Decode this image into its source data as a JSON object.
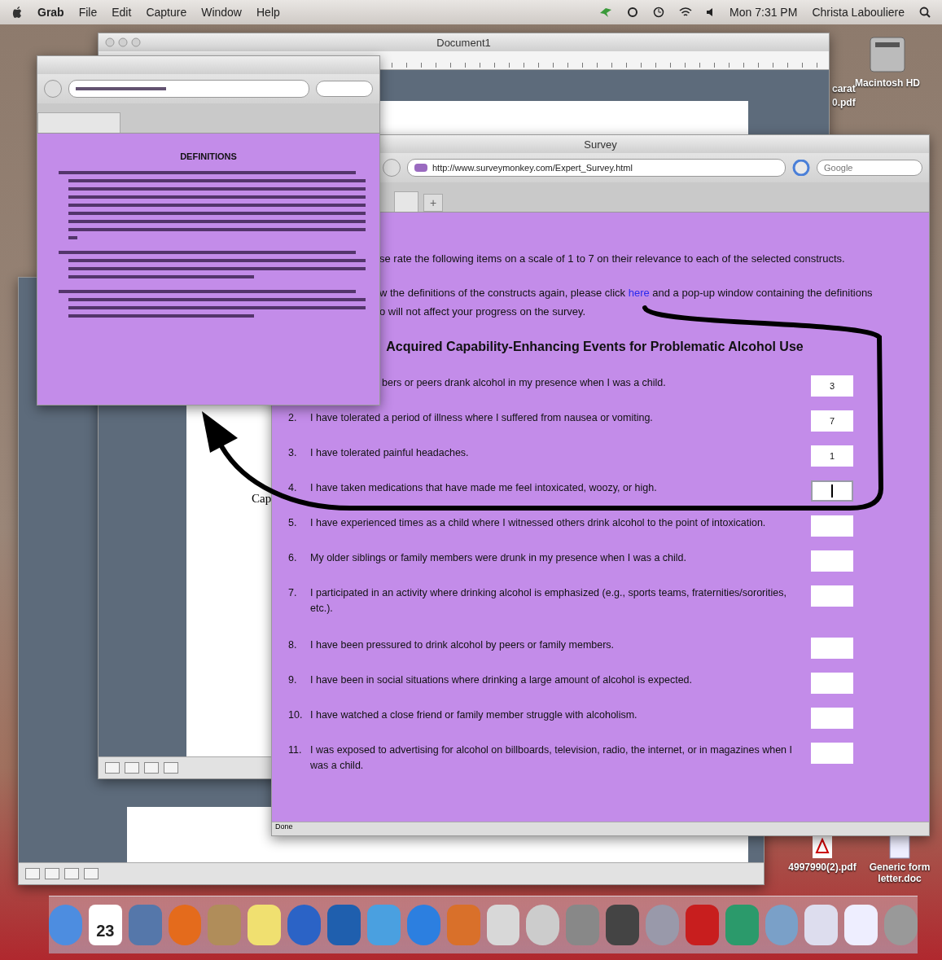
{
  "menu_bar": {
    "app_name": "Grab",
    "menus": [
      "File",
      "Edit",
      "Capture",
      "Window",
      "Help"
    ],
    "clock": "Mon 7:31 PM",
    "user": "Christa Labouliere"
  },
  "document_window": {
    "title": "Document1",
    "page_text": "Cap"
  },
  "definitions_window": {
    "heading": "DEFINITIONS"
  },
  "survey_window": {
    "title": "Survey",
    "url": "http://www.surveymonkey.com/Expert_Survey.html",
    "search_placeholder": "Google",
    "new_tab": "+",
    "intro_1": "se rate the following items on a scale of 1 to 7 on their relevance to each of the selected constructs.",
    "intro_2": {
      "before": "w the definitions of the constructs again, please click ",
      "link": "here",
      "after": " and a pop-up window containing the definitions"
    },
    "intro_3": "o will not affect your progress on the survey.",
    "heading": "Acquired Capability-Enhancing Events for Problematic Alcohol Use",
    "items": [
      {
        "text": "bers or peers drank alcohol in my presence when I was a child.",
        "answer": "3",
        "focused": false
      },
      {
        "number": "2.",
        "text": "I have tolerated a period of illness where I suffered from nausea or vomiting.",
        "answer": "7",
        "focused": false
      },
      {
        "number": "3.",
        "text": "I have tolerated painful headaches.",
        "answer": "1",
        "focused": false
      },
      {
        "number": "4.",
        "text": "I have taken medications that have made me feel intoxicated, woozy, or high.",
        "focused": true
      },
      {
        "number": "5.",
        "text": "I have experienced times as a child where I witnessed others drink alcohol to the point of intoxication.",
        "focused": false
      },
      {
        "number": "6.",
        "text": "My older siblings or family members were drunk in my presence when I was a child.",
        "focused": false
      },
      {
        "number": "7.",
        "text": "I participated in an activity where drinking alcohol is emphasized (e.g., sports teams, fraternities/sororities, etc.).",
        "focused": false
      },
      {
        "number": "8.",
        "text": "I have been pressured to drink alcohol by peers or family members.",
        "focused": false
      },
      {
        "number": "9.",
        "text": "I have been in social situations where drinking a large amount of alcohol is expected.",
        "focused": false
      },
      {
        "number": "10.",
        "text": "I have watched a close friend or family member struggle with alcoholism.",
        "focused": false
      },
      {
        "number": "11.",
        "text": "I was exposed to advertising for alcohol on billboards, television, radio, the internet, or in magazines when I was a child.",
        "focused": false
      }
    ],
    "status": "Done"
  },
  "desktop_icons": [
    {
      "kind": "disk",
      "label": "Macintosh HD"
    },
    {
      "kind": "pdf",
      "label": "4997990(2).pdf"
    },
    {
      "kind": "doc",
      "label": "Generic form letter.doc"
    }
  ],
  "partial_file_label": [
    "carat",
    "0.pdf"
  ],
  "dock": {
    "calendar_day": "23"
  }
}
